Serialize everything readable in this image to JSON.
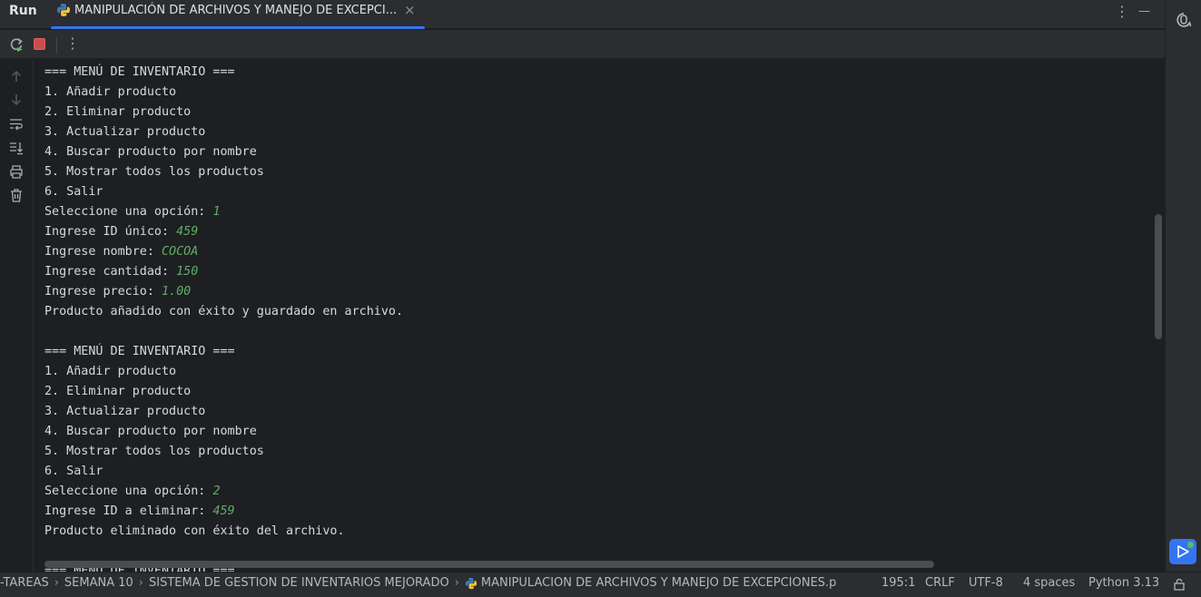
{
  "window": {
    "run_label": "Run",
    "tab_title": "MANIPULACIÓN DE ARCHIVOS Y MANEJO DE EXCEPCI...",
    "tab_close": "×",
    "more_icon": "⋮",
    "minimize_icon": "—"
  },
  "toolbar": {
    "rerun_icon": "rerun-icon",
    "stop_icon": "stop-icon",
    "more": "⋮"
  },
  "sidebar": {
    "icons": [
      "arrow-up-icon",
      "arrow-down-icon",
      "soft-wrap-icon",
      "scroll-to-end-icon",
      "print-icon",
      "trash-icon"
    ]
  },
  "console": {
    "lines": [
      {
        "text": "=== MENÚ DE INVENTARIO ===",
        "input": ""
      },
      {
        "text": "1. Añadir producto",
        "input": ""
      },
      {
        "text": "2. Eliminar producto",
        "input": ""
      },
      {
        "text": "3. Actualizar producto",
        "input": ""
      },
      {
        "text": "4. Buscar producto por nombre",
        "input": ""
      },
      {
        "text": "5. Mostrar todos los productos",
        "input": ""
      },
      {
        "text": "6. Salir",
        "input": ""
      },
      {
        "text": "Seleccione una opción: ",
        "input": "1"
      },
      {
        "text": "Ingrese ID único: ",
        "input": "459"
      },
      {
        "text": "Ingrese nombre: ",
        "input": "COCOA"
      },
      {
        "text": "Ingrese cantidad: ",
        "input": "150"
      },
      {
        "text": "Ingrese precio: ",
        "input": "1.00"
      },
      {
        "text": "Producto añadido con éxito y guardado en archivo.",
        "input": ""
      },
      {
        "text": "",
        "input": ""
      },
      {
        "text": "=== MENÚ DE INVENTARIO ===",
        "input": ""
      },
      {
        "text": "1. Añadir producto",
        "input": ""
      },
      {
        "text": "2. Eliminar producto",
        "input": ""
      },
      {
        "text": "3. Actualizar producto",
        "input": ""
      },
      {
        "text": "4. Buscar producto por nombre",
        "input": ""
      },
      {
        "text": "5. Mostrar todos los productos",
        "input": ""
      },
      {
        "text": "6. Salir",
        "input": ""
      },
      {
        "text": "Seleccione una opción: ",
        "input": "2"
      },
      {
        "text": "Ingrese ID a eliminar: ",
        "input": "459"
      },
      {
        "text": "Producto eliminado con éxito del archivo.",
        "input": ""
      },
      {
        "text": "",
        "input": ""
      },
      {
        "text": "=== MENÚ DE INVENTARIO ===",
        "input": ""
      }
    ]
  },
  "right_strip": {
    "ai_icon": "ai-assistant-icon",
    "run_badge_icon": "run-triangle-icon"
  },
  "statusbar": {
    "breadcrumbs": [
      "-TAREAS",
      "SEMANA 10",
      "SISTEMA DE GESTIÓN DE INVENTARIOS MEJORADO",
      "MANIPULACIÓN DE ARCHIVOS Y MANEJO DE EXCEPCIONES.p"
    ],
    "position": "195:1",
    "line_ending": "CRLF",
    "encoding": "UTF-8",
    "indent": "4 spaces",
    "interpreter": "Python 3.13"
  },
  "colors": {
    "accent": "#3574f0",
    "input_text": "#5fad65",
    "stop": "#db5c5c"
  }
}
